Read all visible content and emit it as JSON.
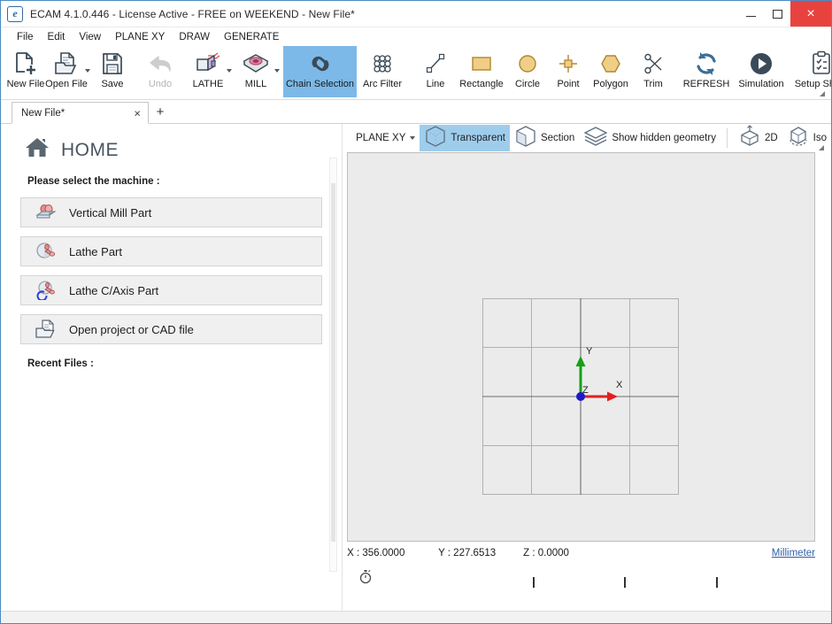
{
  "window": {
    "title": "ECAM 4.1.0.446 - License Active -  FREE on WEEKEND  - New File*",
    "app_icon": "e-logo-icon",
    "minimize_label": "−",
    "maximize_label": "□",
    "close_label": "×",
    "close_color": "#e8423f"
  },
  "menubar": {
    "items": [
      {
        "label": "File"
      },
      {
        "label": "Edit"
      },
      {
        "label": "View"
      },
      {
        "label": "PLANE XY"
      },
      {
        "label": "DRAW"
      },
      {
        "label": "GENERATE"
      }
    ]
  },
  "ribbon": {
    "accent": "#7cb9e8",
    "tools": [
      {
        "label": "New File",
        "icon": "new-file-icon",
        "state": "normal",
        "caret": false
      },
      {
        "label": "Open File",
        "icon": "open-file-icon",
        "state": "normal",
        "caret": true
      },
      {
        "label": "Save",
        "icon": "save-icon",
        "state": "normal",
        "caret": false
      },
      {
        "label": "Undo",
        "icon": "undo-icon",
        "state": "disabled",
        "caret": false
      },
      {
        "label": "LATHE",
        "icon": "lathe-icon",
        "state": "normal",
        "caret": true
      },
      {
        "label": "MILL",
        "icon": "mill-icon",
        "state": "normal",
        "caret": true
      },
      {
        "label": "Chain Selection",
        "icon": "chain-link-icon",
        "state": "active",
        "caret": false
      },
      {
        "label": "Arc Filter",
        "icon": "arc-filter-icon",
        "state": "normal",
        "caret": false
      },
      {
        "label": "Line",
        "icon": "line-icon",
        "state": "normal",
        "caret": false
      },
      {
        "label": "Rectangle",
        "icon": "rectangle-icon",
        "state": "normal",
        "caret": false
      },
      {
        "label": "Circle",
        "icon": "circle-icon",
        "state": "normal",
        "caret": false
      },
      {
        "label": "Point",
        "icon": "point-icon",
        "state": "normal",
        "caret": false
      },
      {
        "label": "Polygon",
        "icon": "polygon-icon",
        "state": "normal",
        "caret": false
      },
      {
        "label": "Trim",
        "icon": "scissors-icon",
        "state": "normal",
        "caret": false
      },
      {
        "label": "REFRESH",
        "icon": "refresh-icon",
        "state": "normal",
        "caret": false
      },
      {
        "label": "Simulation",
        "icon": "play-icon",
        "state": "normal",
        "caret": false
      },
      {
        "label": "Setup Sheet",
        "icon": "clipboard-check-icon",
        "state": "normal",
        "caret": false
      }
    ]
  },
  "tabbar": {
    "tabs": [
      {
        "label": "New File*",
        "close_label": "×"
      }
    ],
    "add_label": "+"
  },
  "home": {
    "icon": "home-icon",
    "title": "HOME",
    "prompt": "Please select the machine :",
    "machines": [
      {
        "label": "Vertical Mill Part",
        "icon": "vertical-mill-icon"
      },
      {
        "label": "Lathe Part",
        "icon": "lathe-part-icon"
      },
      {
        "label": "Lathe C/Axis Part",
        "icon": "lathe-caxis-icon"
      },
      {
        "label": "Open project or CAD file",
        "icon": "open-folder-icon"
      }
    ],
    "recent_label": "Recent Files :"
  },
  "view_toolbar": {
    "plane_label": "PLANE XY",
    "items": [
      {
        "label": "Transparent",
        "icon": "cube-transparent-icon",
        "active": true
      },
      {
        "label": "Section",
        "icon": "cube-section-icon",
        "active": false
      },
      {
        "label": "Show hidden geometry",
        "icon": "layers-icon",
        "active": false
      },
      {
        "label": "2D",
        "icon": "cube-top-icon",
        "active": false
      },
      {
        "label": "Iso",
        "icon": "cube-iso-icon",
        "active": false
      }
    ]
  },
  "viewport": {
    "background": "#ebebeb",
    "grid_cells": 4,
    "axis": {
      "x_label": "X",
      "y_label": "Y",
      "z_label": "Z",
      "x_color": "#e02020",
      "y_color": "#16a016",
      "origin_color": "#1a1ac8"
    }
  },
  "status": {
    "x_coord": "X : 356.0000",
    "y_coord": "Y : 227.6513",
    "z_coord": "Z : 0.0000",
    "unit_label": "Millimeter",
    "timer_icon": "stopwatch-icon",
    "tick_count": 3
  }
}
